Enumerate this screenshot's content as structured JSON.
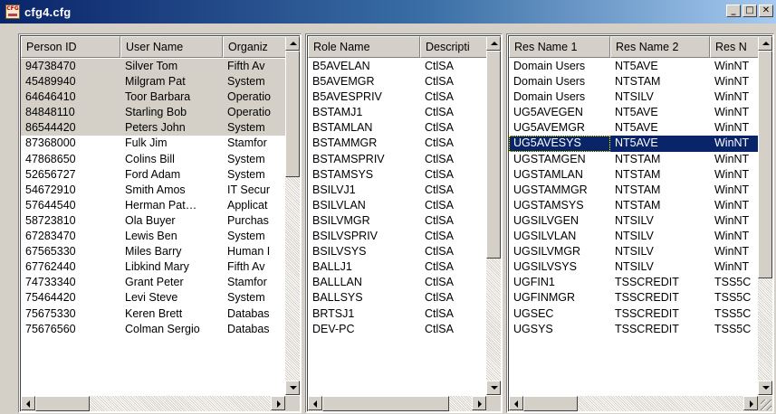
{
  "window": {
    "title": "cfg4.cfg",
    "icon": "cfg-file-icon",
    "icon_text": "CFG",
    "controls": {
      "minimize": "_",
      "maximize": "□",
      "close": "✕"
    }
  },
  "people_pane": {
    "columns": [
      "Person ID",
      "User Name",
      "Organiz"
    ],
    "rows": [
      [
        "94738470",
        "Silver Tom",
        "Fifth Av"
      ],
      [
        "45489940",
        "Milgram Pat",
        "System"
      ],
      [
        "64646410",
        "Toor Barbara",
        "Operatio"
      ],
      [
        "84848110",
        "Starling Bob",
        "Operatio"
      ],
      [
        "86544420",
        "Peters John",
        "System"
      ],
      [
        "87368000",
        "Fulk Jim",
        "Stamfor"
      ],
      [
        "47868650",
        "Colins Bill",
        "System"
      ],
      [
        "52656727",
        "Ford Adam",
        "System"
      ],
      [
        "54672910",
        "Smith Amos",
        "IT Secur"
      ],
      [
        "57644540",
        "Herman Pat…",
        "Applicat"
      ],
      [
        "58723810",
        "Ola Buyer",
        "Purchas"
      ],
      [
        "67283470",
        "Lewis Ben",
        "System"
      ],
      [
        "67565330",
        "Miles Barry",
        "Human I"
      ],
      [
        "67762440",
        "Libkind Mary",
        "Fifth Av"
      ],
      [
        "74733340",
        "Grant Peter",
        "Stamfor"
      ],
      [
        "75464420",
        "Levi Steve",
        "System"
      ],
      [
        "75675330",
        "Keren Brett",
        "Databas"
      ],
      [
        "75676560",
        "Colman Sergio",
        "Databas"
      ]
    ]
  },
  "roles_pane": {
    "columns": [
      "Role Name",
      "Descripti"
    ],
    "rows": [
      [
        "B5AVELAN",
        "CtlSA"
      ],
      [
        "B5AVEMGR",
        "CtlSA"
      ],
      [
        "B5AVESPRIV",
        "CtlSA"
      ],
      [
        "BSTAMJ1",
        "CtlSA"
      ],
      [
        "BSTAMLAN",
        "CtlSA"
      ],
      [
        "BSTAMMGR",
        "CtlSA"
      ],
      [
        "BSTAMSPRIV",
        "CtlSA"
      ],
      [
        "BSTAMSYS",
        "CtlSA"
      ],
      [
        "BSILVJ1",
        "CtlSA"
      ],
      [
        "BSILVLAN",
        "CtlSA"
      ],
      [
        "BSILVMGR",
        "CtlSA"
      ],
      [
        "BSILVSPRIV",
        "CtlSA"
      ],
      [
        "BSILVSYS",
        "CtlSA"
      ],
      [
        "BALLJ1",
        "CtlSA"
      ],
      [
        "BALLLAN",
        "CtlSA"
      ],
      [
        "BALLSYS",
        "CtlSA"
      ],
      [
        "BRTSJ1",
        "CtlSA"
      ],
      [
        "DEV-PC",
        "CtlSA"
      ]
    ]
  },
  "resources_pane": {
    "columns": [
      "Res Name 1",
      "Res Name 2",
      "Res N"
    ],
    "rows": [
      [
        "Domain Users",
        "NT5AVE",
        "WinNT"
      ],
      [
        "Domain Users",
        "NTSTAM",
        "WinNT"
      ],
      [
        "Domain Users",
        "NTSILV",
        "WinNT"
      ],
      [
        "UG5AVEGEN",
        "NT5AVE",
        "WinNT"
      ],
      [
        "UG5AVEMGR",
        "NT5AVE",
        "WinNT"
      ],
      [
        "UG5AVESYS",
        "NT5AVE",
        "WinNT"
      ],
      [
        "UGSTAMGEN",
        "NTSTAM",
        "WinNT"
      ],
      [
        "UGSTAMLAN",
        "NTSTAM",
        "WinNT"
      ],
      [
        "UGSTAMMGR",
        "NTSTAM",
        "WinNT"
      ],
      [
        "UGSTAMSYS",
        "NTSTAM",
        "WinNT"
      ],
      [
        "UGSILVGEN",
        "NTSILV",
        "WinNT"
      ],
      [
        "UGSILVLAN",
        "NTSILV",
        "WinNT"
      ],
      [
        "UGSILVMGR",
        "NTSILV",
        "WinNT"
      ],
      [
        "UGSILVSYS",
        "NTSILV",
        "WinNT"
      ],
      [
        "UGFIN1",
        "TSSCREDIT",
        "TSS5C"
      ],
      [
        "UGFINMGR",
        "TSSCREDIT",
        "TSS5C"
      ],
      [
        "UGSEC",
        "TSSCREDIT",
        "TSS5C"
      ],
      [
        "UGSYS",
        "TSSCREDIT",
        "TSS5C"
      ]
    ]
  },
  "colors": {
    "title_gradient_start": "#0a246a",
    "title_gradient_end": "#a6caf0",
    "selection_blue": "#0a246a",
    "selection_grey": "#d4d0c8",
    "face": "#d4d0c8"
  }
}
